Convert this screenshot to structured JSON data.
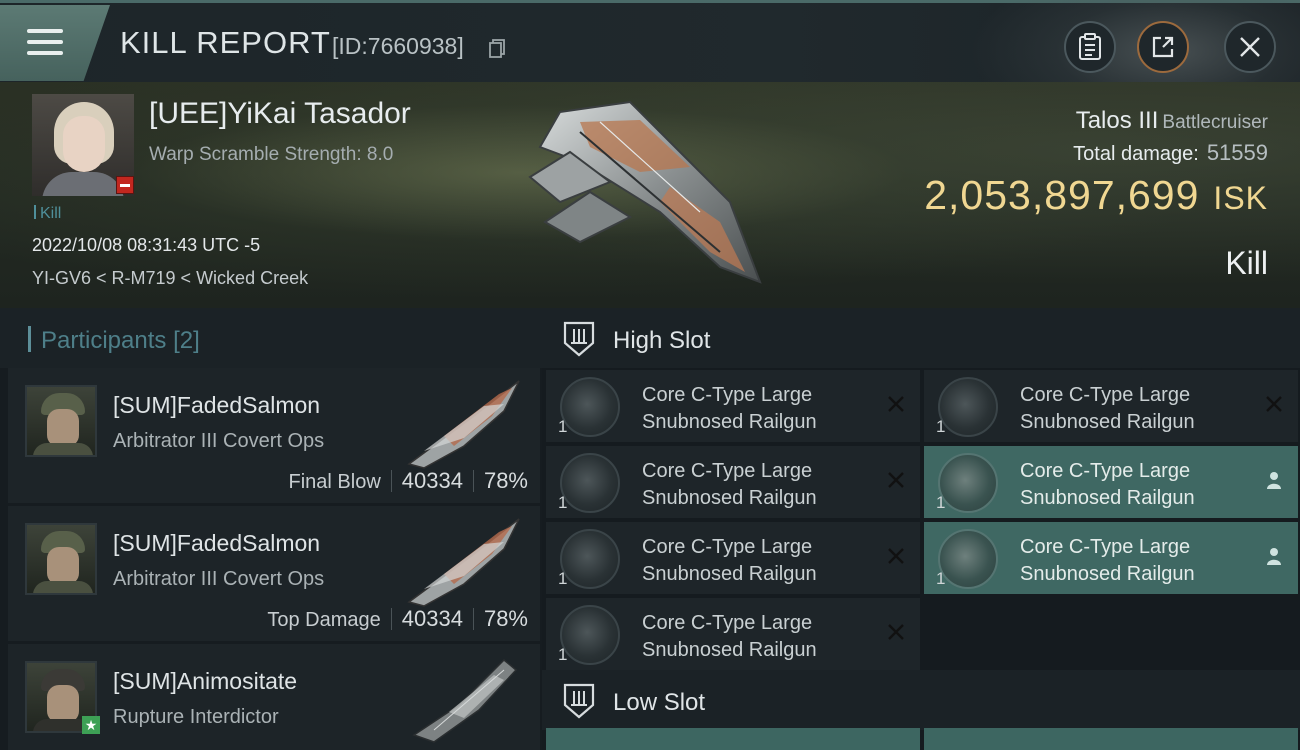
{
  "header": {
    "title": "KILL REPORT",
    "report_id": "[ID:7660938]"
  },
  "victim": {
    "name": "[UEE]YiKai Tasador",
    "warp_scramble": "Warp Scramble Strength: 8.0",
    "kill_tag": "Kill",
    "datetime": "2022/10/08 08:31:43 UTC -5",
    "location": "YI-GV6 < R-M719 < Wicked Creek",
    "ship_name": "Talos III",
    "ship_class": "Battlecruiser",
    "total_damage_label": "Total damage:",
    "total_damage": "51559",
    "isk_value": "2,053,897,699",
    "isk_unit": "ISK",
    "result": "Kill"
  },
  "participants": {
    "title": "Participants",
    "count": "[2]",
    "rows": [
      {
        "name": "[SUM]FadedSalmon",
        "ship": "Arbitrator III Covert Ops",
        "role": "Final Blow",
        "damage": "40334",
        "percent": "78%"
      },
      {
        "name": "[SUM]FadedSalmon",
        "ship": "Arbitrator III Covert Ops",
        "role": "Top Damage",
        "damage": "40334",
        "percent": "78%"
      },
      {
        "name": "[SUM]Animositate",
        "ship": "Rupture Interdictor"
      }
    ]
  },
  "fittings": {
    "high_slot_label": "High Slot",
    "low_slot_label": "Low Slot",
    "modules": [
      {
        "qty": "1",
        "line1": "Core C-Type Large",
        "line2": "Snubnosed Railgun",
        "status": "destroyed"
      },
      {
        "qty": "1",
        "line1": "Core C-Type Large",
        "line2": "Snubnosed Railgun",
        "status": "destroyed"
      },
      {
        "qty": "1",
        "line1": "Core C-Type Large",
        "line2": "Snubnosed Railgun",
        "status": "destroyed"
      },
      {
        "qty": "1",
        "line1": "Core C-Type Large",
        "line2": "Snubnosed Railgun",
        "status": "dropped"
      },
      {
        "qty": "1",
        "line1": "Core C-Type Large",
        "line2": "Snubnosed Railgun",
        "status": "destroyed"
      },
      {
        "qty": "1",
        "line1": "Core C-Type Large",
        "line2": "Snubnosed Railgun",
        "status": "dropped"
      },
      {
        "qty": "1",
        "line1": "Core C-Type Large",
        "line2": "Snubnosed Railgun",
        "status": "destroyed"
      }
    ]
  },
  "colors": {
    "accent_teal": "#3f6863",
    "isk_gold": "#f0d792",
    "security_red": "#c2271f",
    "participants_title": "#4e7f89"
  },
  "icons": [
    "menu-icon",
    "copy-icon",
    "clipboard-icon",
    "share-icon",
    "close-icon",
    "high-slot-icon",
    "low-slot-icon",
    "destroyed-x-icon",
    "dropped-person-icon",
    "security-minus-icon",
    "star-icon"
  ]
}
